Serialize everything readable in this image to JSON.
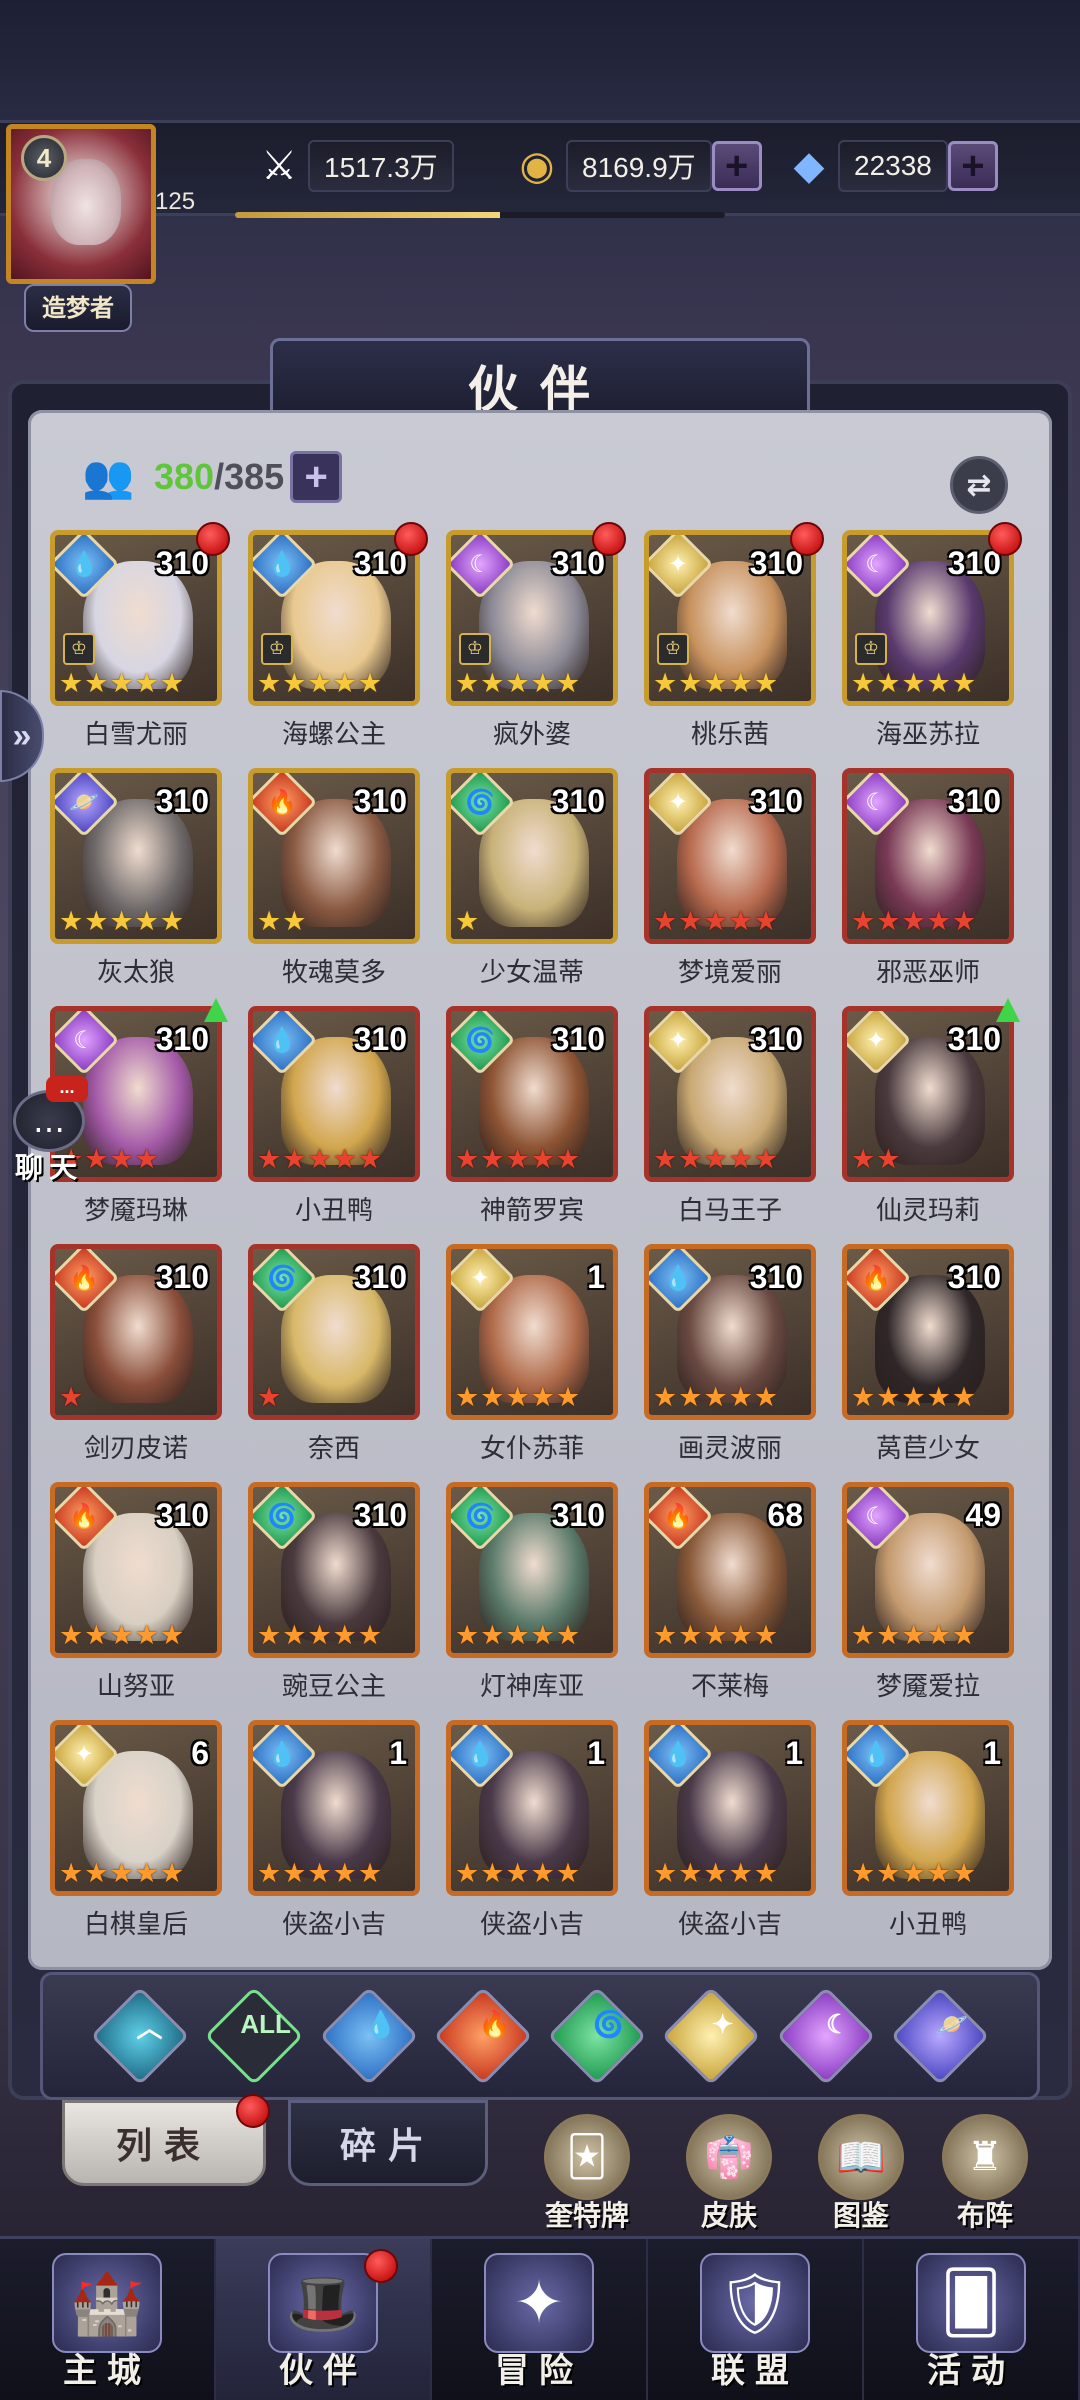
{
  "player": {
    "level": "4",
    "id_number": "125",
    "title": "造梦者",
    "xp_fraction": 0.54
  },
  "resources": {
    "power": "1517.3万",
    "gold": "8169.9万",
    "diamonds": "22338"
  },
  "panel": {
    "title": "伙伴",
    "count_current": "380",
    "count_sep": "/",
    "count_max": "385"
  },
  "heroes": [
    {
      "name": "白雪尤丽",
      "level": "310",
      "element": "water",
      "stars": 5,
      "star_color": "gold",
      "frame": "gold",
      "red_dot": true,
      "crown": true,
      "skin": "#d7d6e2"
    },
    {
      "name": "海螺公主",
      "level": "310",
      "element": "water",
      "stars": 5,
      "star_color": "gold",
      "frame": "gold",
      "red_dot": true,
      "crown": true,
      "skin": "#e9c98f"
    },
    {
      "name": "疯外婆",
      "level": "310",
      "element": "dark",
      "stars": 5,
      "star_color": "gold",
      "frame": "gold",
      "red_dot": true,
      "crown": true,
      "skin": "#8c8a96"
    },
    {
      "name": "桃乐茜",
      "level": "310",
      "element": "light",
      "stars": 5,
      "star_color": "gold",
      "frame": "gold",
      "red_dot": true,
      "crown": true,
      "skin": "#c8925e"
    },
    {
      "name": "海巫苏拉",
      "level": "310",
      "element": "dark",
      "stars": 5,
      "star_color": "gold",
      "frame": "gold",
      "red_dot": true,
      "crown": true,
      "skin": "#5a3a6e"
    },
    {
      "name": "灰太狼",
      "level": "310",
      "element": "void",
      "stars": 5,
      "star_color": "gold",
      "frame": "gold",
      "red_dot": false,
      "crown": false,
      "skin": "#6f6a6a"
    },
    {
      "name": "牧魂莫多",
      "level": "310",
      "element": "fire",
      "stars": 2,
      "star_color": "gold",
      "frame": "gold",
      "red_dot": false,
      "crown": false,
      "skin": "#8a5a42"
    },
    {
      "name": "少女温蒂",
      "level": "310",
      "element": "wind",
      "stars": 1,
      "star_color": "gold",
      "frame": "gold",
      "red_dot": false,
      "crown": false,
      "skin": "#c8b278"
    },
    {
      "name": "梦境爱丽",
      "level": "310",
      "element": "light",
      "stars": 5,
      "star_color": "red",
      "frame": "red",
      "red_dot": false,
      "crown": false,
      "skin": "#b86a4e"
    },
    {
      "name": "邪恶巫师",
      "level": "310",
      "element": "dark",
      "stars": 5,
      "star_color": "red",
      "frame": "red",
      "red_dot": false,
      "crown": false,
      "skin": "#7a3a56"
    },
    {
      "name": "梦魇玛琳",
      "level": "310",
      "element": "dark",
      "stars": 4,
      "star_color": "red",
      "frame": "red",
      "red_dot": false,
      "crown": false,
      "up_arrow": true,
      "skin": "#a45aa8"
    },
    {
      "name": "小丑鸭",
      "level": "310",
      "element": "water",
      "stars": 5,
      "star_color": "red",
      "frame": "red",
      "red_dot": false,
      "crown": false,
      "skin": "#d2a64e"
    },
    {
      "name": "神箭罗宾",
      "level": "310",
      "element": "wind",
      "stars": 5,
      "star_color": "red",
      "frame": "red",
      "red_dot": false,
      "crown": false,
      "skin": "#8e5434"
    },
    {
      "name": "白马王子",
      "level": "310",
      "element": "light",
      "stars": 5,
      "star_color": "red",
      "frame": "red",
      "red_dot": false,
      "crown": false,
      "skin": "#c8a872"
    },
    {
      "name": "仙灵玛莉",
      "level": "310",
      "element": "light",
      "stars": 2,
      "star_color": "red",
      "frame": "red",
      "red_dot": false,
      "crown": false,
      "up_arrow": true,
      "skin": "#4a3a3e"
    },
    {
      "name": "剑刃皮诺",
      "level": "310",
      "element": "fire",
      "stars": 1,
      "star_color": "red",
      "frame": "red",
      "red_dot": false,
      "crown": false,
      "skin": "#8a4e3a"
    },
    {
      "name": "奈西",
      "level": "310",
      "element": "wind",
      "stars": 1,
      "star_color": "red",
      "frame": "red",
      "red_dot": false,
      "crown": false,
      "skin": "#d8b868"
    },
    {
      "name": "女仆苏菲",
      "level": "1",
      "element": "light",
      "stars": 5,
      "star_color": "orange",
      "frame": "orange",
      "red_dot": false,
      "crown": false,
      "skin": "#b06a4a"
    },
    {
      "name": "画灵波丽",
      "level": "310",
      "element": "water",
      "stars": 5,
      "star_color": "orange",
      "frame": "orange",
      "red_dot": false,
      "crown": false,
      "skin": "#6a4a42"
    },
    {
      "name": "莴苣少女",
      "level": "310",
      "element": "fire",
      "stars": 5,
      "star_color": "orange",
      "frame": "orange",
      "red_dot": false,
      "crown": false,
      "skin": "#2e2628"
    },
    {
      "name": "山努亚",
      "level": "310",
      "element": "fire",
      "stars": 5,
      "star_color": "orange",
      "frame": "orange",
      "red_dot": false,
      "crown": false,
      "skin": "#d8cfc2"
    },
    {
      "name": "豌豆公主",
      "level": "310",
      "element": "wind",
      "stars": 5,
      "star_color": "orange",
      "frame": "orange",
      "red_dot": false,
      "crown": false,
      "skin": "#4a3a3e"
    },
    {
      "name": "灯神库亚",
      "level": "310",
      "element": "wind",
      "stars": 5,
      "star_color": "orange",
      "frame": "orange",
      "red_dot": false,
      "crown": false,
      "skin": "#5a7a6a"
    },
    {
      "name": "不莱梅",
      "level": "68",
      "element": "fire",
      "stars": 5,
      "star_color": "orange",
      "frame": "orange",
      "red_dot": false,
      "crown": false,
      "skin": "#8a5a3a"
    },
    {
      "name": "梦魇爱拉",
      "level": "49",
      "element": "dark",
      "stars": 5,
      "star_color": "orange",
      "frame": "orange",
      "red_dot": false,
      "crown": false,
      "skin": "#c49a6e"
    },
    {
      "name": "白棋皇后",
      "level": "6",
      "element": "light",
      "stars": 5,
      "star_color": "orange",
      "frame": "orange",
      "red_dot": false,
      "crown": false,
      "skin": "#d8d2c8"
    },
    {
      "name": "侠盗小吉",
      "level": "1",
      "element": "water",
      "stars": 5,
      "star_color": "orange",
      "frame": "orange",
      "red_dot": false,
      "crown": false,
      "skin": "#4a3a4a"
    },
    {
      "name": "侠盗小吉",
      "level": "1",
      "element": "water",
      "stars": 5,
      "star_color": "orange",
      "frame": "orange",
      "red_dot": false,
      "crown": false,
      "skin": "#4a3a4a"
    },
    {
      "name": "侠盗小吉",
      "level": "1",
      "element": "water",
      "stars": 5,
      "star_color": "orange",
      "frame": "orange",
      "red_dot": false,
      "crown": false,
      "skin": "#4a3a4a"
    },
    {
      "name": "小丑鸭",
      "level": "1",
      "element": "water",
      "stars": 5,
      "star_color": "orange",
      "frame": "orange",
      "red_dot": false,
      "crown": false,
      "skin": "#d2a64e"
    }
  ],
  "filters": [
    {
      "id": "base",
      "icon": "arrow-up-icon"
    },
    {
      "id": "all",
      "label": "ALL"
    },
    {
      "id": "water",
      "icon": "water-drop-icon"
    },
    {
      "id": "fire",
      "icon": "fire-icon"
    },
    {
      "id": "wind",
      "icon": "wind-icon"
    },
    {
      "id": "light",
      "icon": "light-icon"
    },
    {
      "id": "dark",
      "icon": "moon-icon"
    },
    {
      "id": "void",
      "icon": "planet-icon"
    }
  ],
  "tabs": {
    "list": "列表",
    "fragments": "碎片"
  },
  "quick_buttons": {
    "card": "奎特牌",
    "skin": "皮肤",
    "codex": "图鉴",
    "formation": "布阵"
  },
  "nav": {
    "city": "主城",
    "partners": "伙伴",
    "adventure": "冒险",
    "alliance": "联盟",
    "events": "活动"
  },
  "chat": {
    "label": "聊天",
    "badge": "..."
  },
  "colors": {
    "gold_frame": "#c89b2d",
    "red_frame": "#a5332a",
    "orange_frame": "#c66a24",
    "count_green": "#5fc53a",
    "panel_bg": "#c9cad3"
  }
}
